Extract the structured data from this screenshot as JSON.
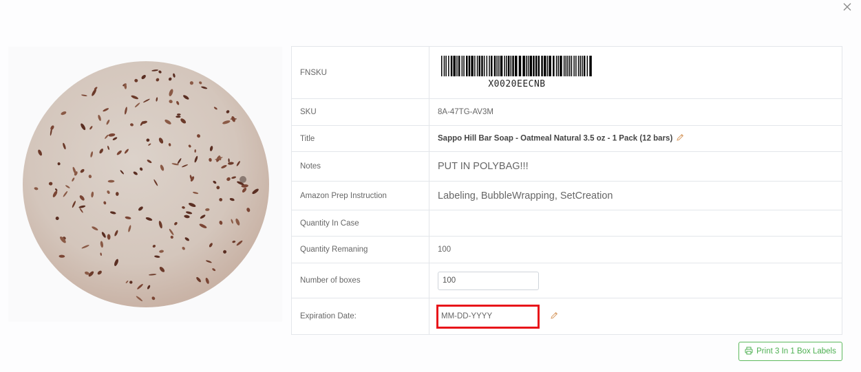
{
  "close_icon": "close-icon",
  "product": {
    "image": "sappo-hill-oatmeal-soap-photo"
  },
  "fields": {
    "fnsku": {
      "label": "FNSKU",
      "value": "X0020EECNB"
    },
    "sku": {
      "label": "SKU",
      "value": "8A-47TG-AV3M"
    },
    "title": {
      "label": "Title",
      "value": "Sappo Hill Bar Soap - Oatmeal Natural 3.5 oz - 1 Pack (12 bars)"
    },
    "notes": {
      "label": "Notes",
      "value": "PUT IN POLYBAG!!!"
    },
    "prep": {
      "label": "Amazon Prep Instruction",
      "value": "Labeling, BubbleWrapping, SetCreation"
    },
    "qty_case": {
      "label": "Quantity In Case",
      "value": ""
    },
    "qty_remaining": {
      "label": "Quantity Remaning",
      "value": "100"
    },
    "num_boxes": {
      "label": "Number of boxes",
      "value": "100"
    },
    "expiration": {
      "label": "Expiration Date:",
      "value": "",
      "placeholder": "MM-DD-YYYY"
    }
  },
  "print_button": {
    "label": "Print 3 In 1 Box Labels",
    "icon": "printer-icon"
  },
  "colors": {
    "notes_red": "#e0403a",
    "highlight_red": "#e8141a",
    "button_green": "#4caf50"
  }
}
